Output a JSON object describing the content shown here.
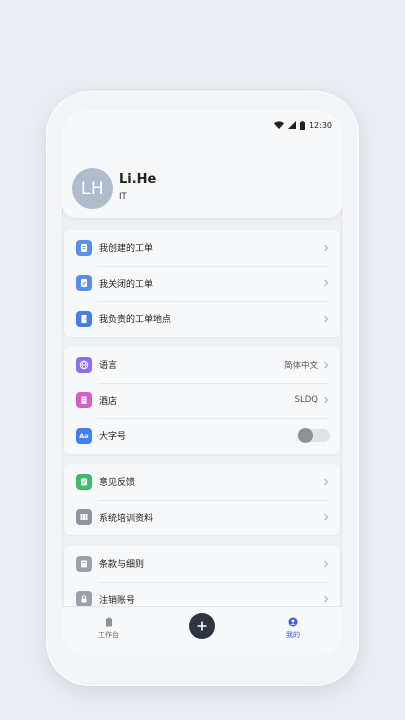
{
  "status_bar": {
    "time": "12:30",
    "icons": [
      "wifi-icon",
      "signal-icon",
      "battery-icon"
    ]
  },
  "profile": {
    "initials": "LH",
    "name": "Li.He",
    "department": "IT"
  },
  "group1": [
    {
      "label": "我创建的工单",
      "icon": "ticket-create-icon",
      "color": "#5b8def"
    },
    {
      "label": "我关闭的工单",
      "icon": "ticket-close-icon",
      "color": "#5b8def"
    },
    {
      "label": "我负责的工单地点",
      "icon": "location-door-icon",
      "color": "#4a7ee6"
    }
  ],
  "group2": [
    {
      "label": "语言",
      "value": "简体中文",
      "icon": "globe-icon",
      "color": "#8e6cf0"
    },
    {
      "label": "酒店",
      "value": "SLDQ",
      "icon": "hotel-icon",
      "color": "#d65fc6"
    },
    {
      "label": "大字号",
      "icon": "font-size-icon",
      "color": "#3d7ff5",
      "toggle_on": false,
      "toggle_glyph": "Aa"
    }
  ],
  "group3": [
    {
      "label": "意见反馈",
      "icon": "feedback-icon",
      "color": "#3dbb6a"
    },
    {
      "label": "系统培训资料",
      "icon": "training-icon",
      "color": "#8c94a6"
    }
  ],
  "group4": [
    {
      "label": "条款与细则",
      "icon": "terms-icon",
      "color": "#9aa1ad"
    },
    {
      "label": "注销账号",
      "icon": "lock-icon",
      "color": "#9aa1ad"
    }
  ],
  "tabbar": {
    "workbench_label": "工作台",
    "mine_label": "我的",
    "active_color": "#3a5bd9"
  }
}
